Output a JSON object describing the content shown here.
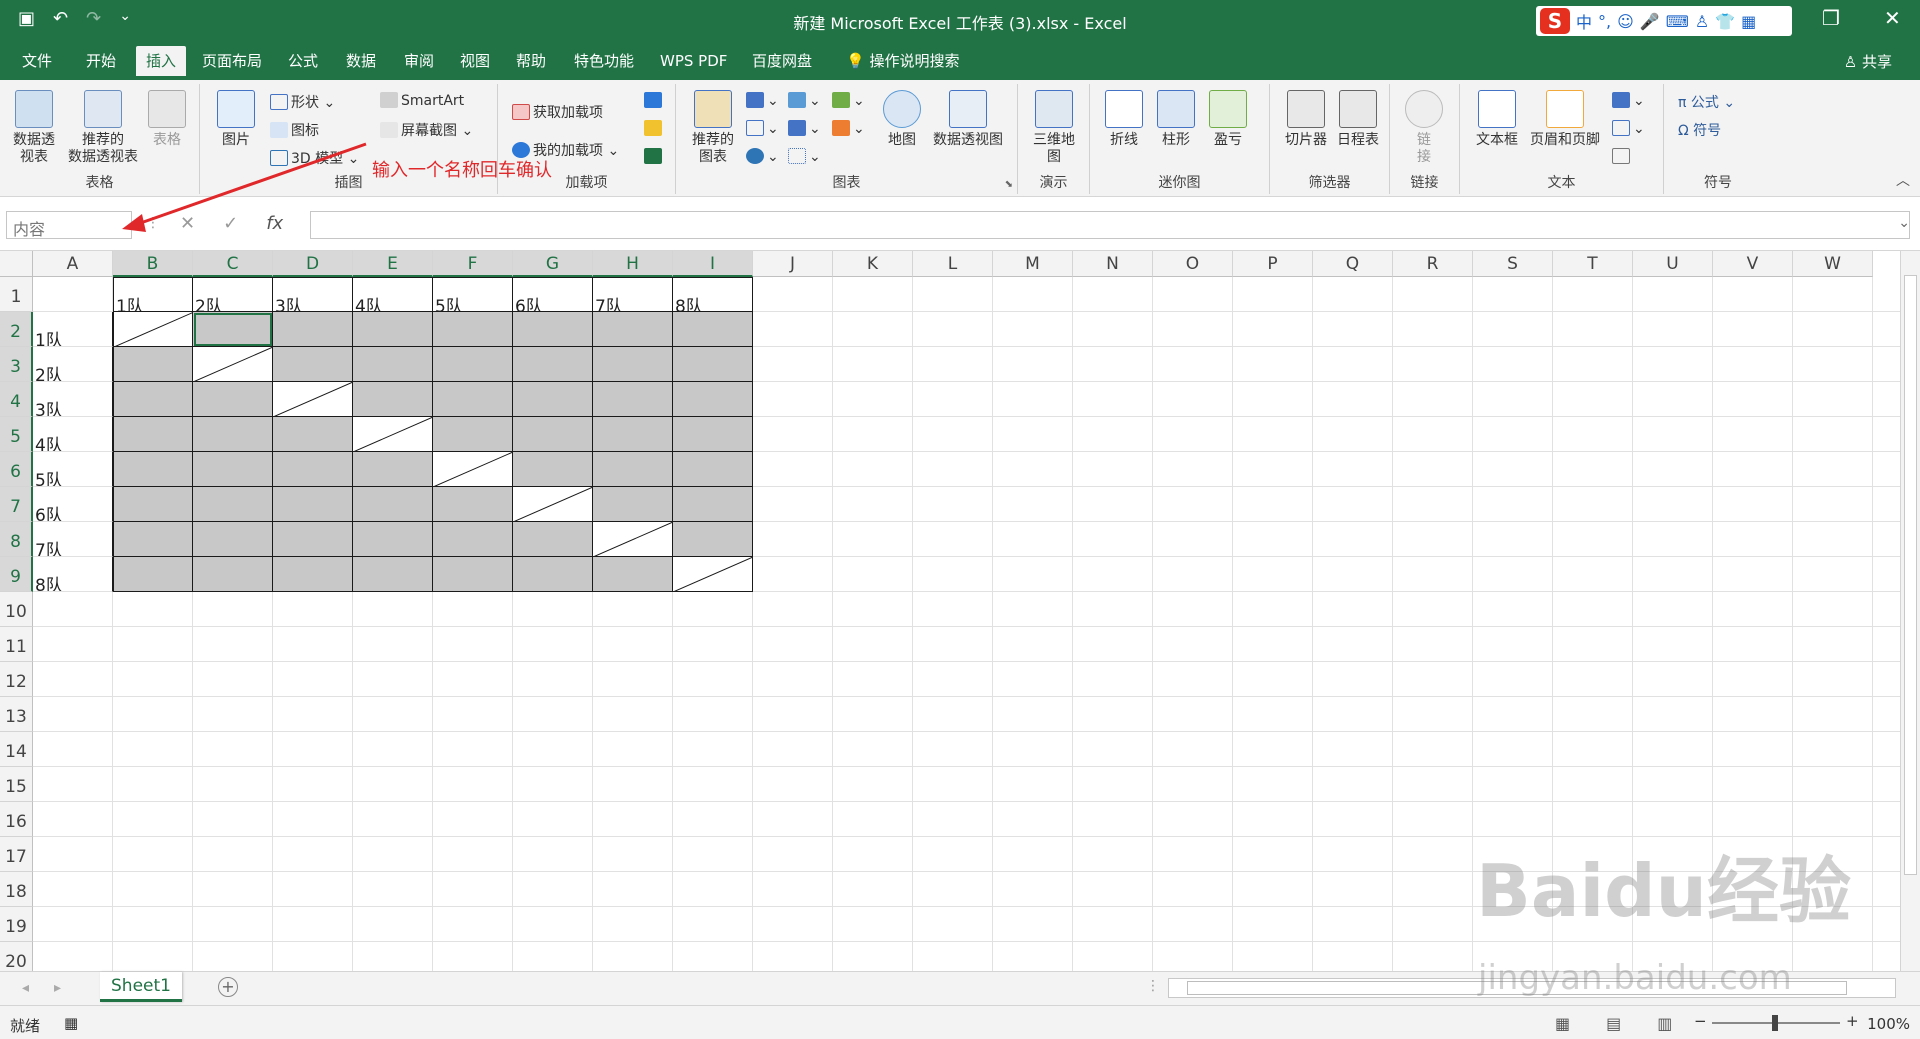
{
  "window": {
    "title": "新建 Microsoft Excel 工作表 (3).xlsx  -  Excel",
    "ime_label": "中",
    "ime_punct": "°,"
  },
  "tabs": [
    "文件",
    "开始",
    "插入",
    "页面布局",
    "公式",
    "数据",
    "审阅",
    "视图",
    "帮助",
    "特色功能",
    "WPS PDF",
    "百度网盘",
    "操作说明搜索"
  ],
  "active_tab": "插入",
  "share_label": "共享",
  "ribbon": {
    "groups": {
      "tables": "表格",
      "illustrations": "插图",
      "addins": "加载项",
      "charts": "图表",
      "tours": "演示",
      "sparklines": "迷你图",
      "filters": "筛选器",
      "links": "链接",
      "text": "文本",
      "symbols": "符号"
    },
    "buttons": {
      "pivot": "数据透\n视表",
      "rec_pivot": "推荐的\n数据透视表",
      "table": "表格",
      "picture": "图片",
      "shapes": "形状",
      "icons": "图标",
      "model3d": "3D 模型",
      "smartart": "SmartArt",
      "screenshot": "屏幕截图",
      "get_addins": "获取加载项",
      "my_addins": "我的加载项",
      "rec_charts": "推荐的\n图表",
      "map": "地图",
      "pivot_chart": "数据透视图",
      "map3d": "三维地\n图",
      "line": "折线",
      "column": "柱形",
      "winloss": "盈亏",
      "slicer": "切片器",
      "timeline": "日程表",
      "link": "链\n接",
      "textbox": "文本框",
      "header_footer": "页眉和页脚",
      "equation": "π 公式",
      "symbol": "Ω 符号"
    }
  },
  "formula_bar": {
    "name_box": "内容",
    "fx": "fx",
    "formula": ""
  },
  "annotation": "输入一个名称回车确认",
  "columns": [
    "A",
    "B",
    "C",
    "D",
    "E",
    "F",
    "G",
    "H",
    "I",
    "J",
    "K",
    "L",
    "M",
    "N",
    "O",
    "P",
    "Q",
    "R",
    "S",
    "T",
    "U",
    "V",
    "W"
  ],
  "rows": [
    "1",
    "2",
    "3",
    "4",
    "5",
    "6",
    "7",
    "8",
    "9",
    "10",
    "11",
    "12",
    "13",
    "14",
    "15",
    "16",
    "17",
    "18",
    "19",
    "20"
  ],
  "table": {
    "header": [
      "1队",
      "2队",
      "3队",
      "4队",
      "5队",
      "6队",
      "7队",
      "8队"
    ],
    "row_labels": [
      "1队",
      "2队",
      "3队",
      "4队",
      "5队",
      "6队",
      "7队",
      "8队"
    ]
  },
  "sheet_tab": "Sheet1",
  "status": {
    "ready": "就绪",
    "zoom": "100%"
  },
  "watermark": "Baidu经验",
  "watermark_url": "jingyan.baidu.com"
}
